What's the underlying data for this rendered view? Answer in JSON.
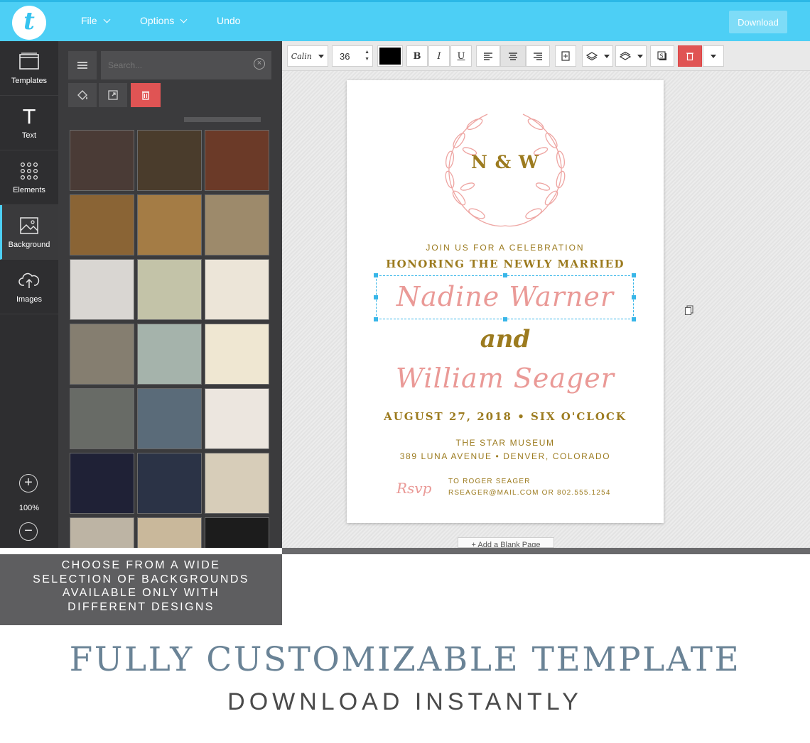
{
  "app": {
    "logo_letter": "t",
    "menu": {
      "file": "File",
      "options": "Options",
      "undo": "Undo"
    },
    "download_label": "Download"
  },
  "sidebar": {
    "items": [
      {
        "label": "Templates",
        "icon": "templates-icon"
      },
      {
        "label": "Text",
        "icon": "text-icon"
      },
      {
        "label": "Elements",
        "icon": "elements-icon"
      },
      {
        "label": "Background",
        "icon": "background-icon",
        "active": true
      },
      {
        "label": "Images",
        "icon": "images-icon"
      }
    ],
    "zoom_label": "100%"
  },
  "panel": {
    "search_placeholder": "Search...",
    "swatches": [
      "#4a3b36",
      "#4a3c2c",
      "#6b3a28",
      "#8a6435",
      "#a47c45",
      "#9d8a6b",
      "#d9d6d2",
      "#c3c3a8",
      "#ece5d8",
      "#857e70",
      "#a5b3ab",
      "#efe7d2",
      "#686b66",
      "#5a6b79",
      "#ece6df",
      "#1f2136",
      "#2b3346",
      "#d7cdb9",
      "#bdb4a4",
      "#c9b89b",
      "#1c1c1c"
    ]
  },
  "toolbar": {
    "font_name": "Calin",
    "font_size": "36",
    "text_color": "#000000",
    "bold": "B",
    "italic": "I",
    "underline": "U"
  },
  "invitation": {
    "monogram": "N & W",
    "line1": "JOIN US FOR A CELEBRATION",
    "line2": "HONORING THE NEWLY MARRIED",
    "name1": "Nadine Warner",
    "and_word": "and",
    "name2": "William Seager",
    "date_line": "AUGUST 27, 2018 • SIX O'CLOCK",
    "venue": "THE STAR MUSEUM",
    "address": "389 LUNA AVENUE • DENVER, COLORADO",
    "rsvp_script": "Rsvp",
    "rsvp_to": "TO ROGER SEAGER",
    "rsvp_contact": "RSEAGER@MAIL.COM OR 802.555.1254",
    "accent_pink": "#ea9a97",
    "accent_gold": "#9c7b1f"
  },
  "add_page_label": "+ Add a Blank Page",
  "caption_lines": [
    "CHOOSE FROM A WIDE",
    "SELECTION OF BACKGROUNDS",
    "AVAILABLE ONLY WITH",
    "DIFFERENT DESIGNS"
  ],
  "headline": "FULLY CUSTOMIZABLE TEMPLATE",
  "subheadline": "DOWNLOAD INSTANTLY"
}
